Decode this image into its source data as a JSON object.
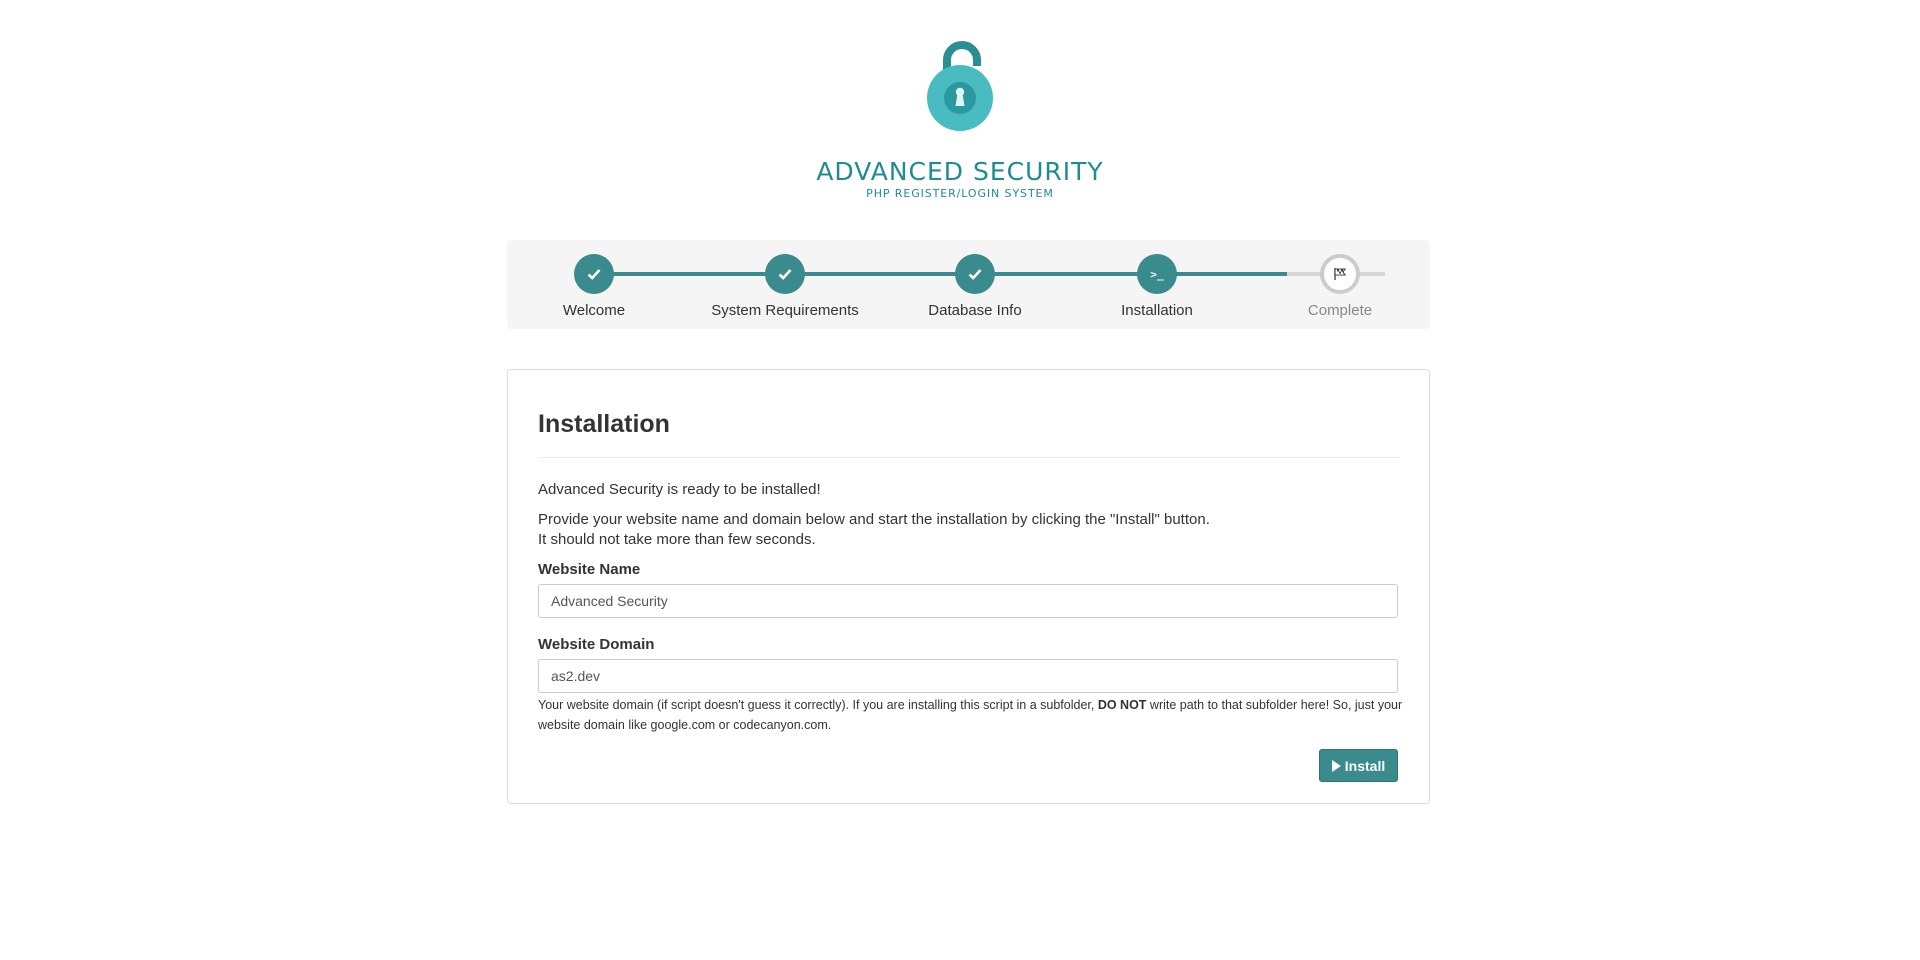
{
  "brand": {
    "title": "ADVANCED SECURITY",
    "subtitle": "PHP REGISTER/LOGIN SYSTEM",
    "logo_icon": "open-padlock-icon",
    "accent_color": "#1f8c91"
  },
  "wizard": {
    "active_color": "#3a8b8d",
    "steps": [
      {
        "label": "Welcome",
        "icon": "check-icon",
        "state": "done"
      },
      {
        "label": "System Requirements",
        "icon": "check-icon",
        "state": "done"
      },
      {
        "label": "Database Info",
        "icon": "check-icon",
        "state": "done"
      },
      {
        "label": "Installation",
        "icon": "terminal-icon",
        "state": "current"
      },
      {
        "label": "Complete",
        "icon": "flag-icon",
        "state": "pending"
      }
    ]
  },
  "panel": {
    "title": "Installation",
    "ready_text": "Advanced Security is ready to be installed!",
    "instructions_line1": "Provide your website name and domain below and start the installation by clicking the \"Install\" button.",
    "instructions_line2": "It should not take more than few seconds.",
    "website_name": {
      "label": "Website Name",
      "value": "Advanced Security"
    },
    "website_domain": {
      "label": "Website Domain",
      "value": "as2.dev",
      "help_before": "Your website domain (if script doesn't guess it correctly). If you are installing this script in a subfolder, ",
      "help_strong": "DO NOT",
      "help_after": " write path to that subfolder here! So, just your website domain like google.com or codecanyon.com."
    },
    "install_button": {
      "label": "Install",
      "icon": "play-icon"
    }
  }
}
